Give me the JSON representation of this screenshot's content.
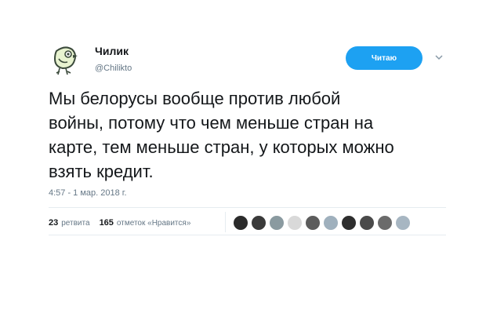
{
  "user": {
    "display_name": "Чилик",
    "handle": "@Chilikto"
  },
  "follow_button": {
    "label": "Читаю"
  },
  "tweet": {
    "text": "Мы белорусы вообще против любой\nвойны, потому что чем меньше стран на\nкарте, тем меньше стран, у которых можно\nвзять кредит.",
    "timestamp": "4:57 - 1 мар. 2018 г."
  },
  "stats": {
    "retweets_count": "23",
    "retweets_label": "ретвита",
    "likes_count": "165",
    "likes_label": "отметок «Нравится»"
  },
  "likers": [
    {
      "icon": "liker-avatar",
      "color": "#2b2b2b"
    },
    {
      "icon": "liker-avatar",
      "color": "#3a3a3a"
    },
    {
      "icon": "liker-avatar",
      "color": "#8a9aa0"
    },
    {
      "icon": "liker-avatar",
      "color": "#d9d9d9"
    },
    {
      "icon": "liker-avatar",
      "color": "#5c5c5c"
    },
    {
      "icon": "liker-avatar",
      "color": "#9fb0bd"
    },
    {
      "icon": "liker-avatar",
      "color": "#2e2e2e"
    },
    {
      "icon": "liker-avatar",
      "color": "#4a4a4a"
    },
    {
      "icon": "liker-avatar",
      "color": "#6b6b6b"
    },
    {
      "icon": "liker-avatar",
      "color": "#a7b6c2"
    }
  ],
  "colors": {
    "accent": "#1da1f2",
    "text": "#14171a",
    "secondary": "#657786"
  }
}
